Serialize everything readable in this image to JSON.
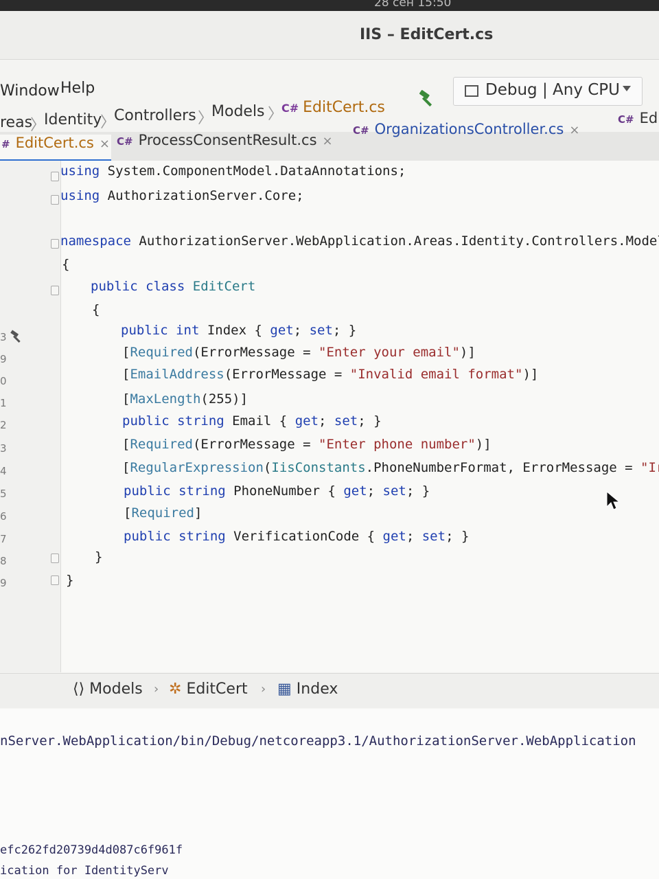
{
  "clock": "28 сен 15:50",
  "window_title": "IIS – EditCert.cs",
  "menu": [
    "Window",
    "Help"
  ],
  "breadcrumb": {
    "items": [
      "reas",
      "Identity",
      "Controllers",
      "Models"
    ],
    "file": "EditCert.cs",
    "file_prefix": "C#"
  },
  "config": {
    "label": "Debug | Any CPU"
  },
  "tabs": [
    {
      "prefix": "#",
      "label": "EditCert.cs",
      "active": true
    },
    {
      "prefix": "C#",
      "label": "ProcessConsentResult.cs",
      "active": false
    },
    {
      "prefix": "C#",
      "label": "OrganizationsController.cs",
      "active": false
    },
    {
      "prefix": "C#",
      "label": "Ed",
      "active": false
    }
  ],
  "code": {
    "line1": {
      "kw": "using",
      "rest": " System.ComponentModel.DataAnnotations;"
    },
    "line2": {
      "kw": "using",
      "rest": " AuthorizationServer.Core;"
    },
    "line4": {
      "kw": "namespace",
      "rest": " AuthorizationServer.WebApplication.Areas.Identity.Controllers.Model"
    },
    "open_brace": "{",
    "class_line": {
      "kw1": "public",
      "kw2": "class",
      "name": "EditCert"
    },
    "class_open": "{",
    "index": {
      "kw1": "public",
      "kw2": "int",
      "name": " Index { ",
      "get": "get",
      "sep": "; ",
      "set": "set",
      "end": "; }"
    },
    "req_email": {
      "open": "[",
      "attr": "Required",
      "mid": "(ErrorMessage = ",
      "str": "\"Enter your email\"",
      "close": ")]"
    },
    "email_addr": {
      "open": "[",
      "attr": "EmailAddress",
      "mid": "(ErrorMessage = ",
      "str": "\"Invalid email format\"",
      "close": ")]"
    },
    "maxlen": {
      "open": "[",
      "attr": "MaxLength",
      "mid": "(255)",
      "close": "]"
    },
    "email_prop": {
      "kw1": "public",
      "kw2": "string",
      "name": " Email { ",
      "get": "get",
      "sep": "; ",
      "set": "set",
      "end": "; }"
    },
    "req_phone": {
      "open": "[",
      "attr": "Required",
      "mid": "(ErrorMessage = ",
      "str": "\"Enter phone number\"",
      "close": ")]"
    },
    "regex": {
      "open": "[",
      "attr": "RegularExpression",
      "mid1": "(",
      "typ": "IisConstants",
      "mid2": ".PhoneNumberFormat, ErrorMessage = ",
      "str": "\"Ir"
    },
    "phone_prop": {
      "kw1": "public",
      "kw2": "string",
      "name": " PhoneNumber { ",
      "get": "get",
      "sep": "; ",
      "set": "set",
      "end": "; }"
    },
    "req_plain": {
      "open": "[",
      "attr": "Required",
      "close": "]"
    },
    "verif_prop": {
      "kw1": "public",
      "kw2": "string",
      "name": " VerificationCode { ",
      "get": "get",
      "sep": "; ",
      "set": "set",
      "end": "; }"
    },
    "class_close": "}",
    "ns_close": "}"
  },
  "line_numbers": [
    "3",
    "9",
    "0",
    "1",
    "2",
    "3",
    "4",
    "5",
    "6",
    "7",
    "8",
    "9"
  ],
  "bottom_breadcrumb": [
    "Models",
    "EditCert",
    "Index"
  ],
  "output": {
    "line1": "nServer.WebApplication/bin/Debug/netcoreapp3.1/AuthorizationServer.WebApplication",
    "line2": "efc262fd20739d4d087c6f961f",
    "line3": "ication for IdentityServ"
  },
  "colors": {
    "keyword": "#1f3fb0",
    "attribute": "#3a7aa0",
    "string": "#9a2d2d",
    "active_tab": "#b06a10"
  }
}
